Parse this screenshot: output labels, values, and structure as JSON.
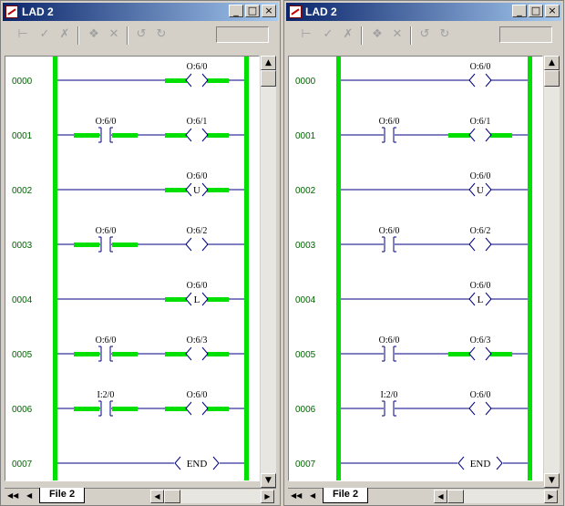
{
  "windows": [
    {
      "title": "LAD 2",
      "tab_label": "File 2",
      "rungs": [
        {
          "number": "0000",
          "inputs": [],
          "output": {
            "address": "O:6/0",
            "symbol": "",
            "energized": true
          }
        },
        {
          "number": "0001",
          "inputs": [
            {
              "address": "O:6/0",
              "energized": true
            }
          ],
          "output": {
            "address": "O:6/1",
            "symbol": "",
            "energized": true
          }
        },
        {
          "number": "0002",
          "inputs": [],
          "output": {
            "address": "O:6/0",
            "symbol": "U",
            "energized": true
          }
        },
        {
          "number": "0003",
          "inputs": [
            {
              "address": "O:6/0",
              "energized": true
            }
          ],
          "output": {
            "address": "O:6/2",
            "symbol": "",
            "energized": false
          }
        },
        {
          "number": "0004",
          "inputs": [],
          "output": {
            "address": "O:6/0",
            "symbol": "L",
            "energized": true
          }
        },
        {
          "number": "0005",
          "inputs": [
            {
              "address": "O:6/0",
              "energized": true
            }
          ],
          "output": {
            "address": "O:6/3",
            "symbol": "",
            "energized": true
          }
        },
        {
          "number": "0006",
          "inputs": [
            {
              "address": "I:2/0",
              "energized": true
            }
          ],
          "output": {
            "address": "O:6/0",
            "symbol": "",
            "energized": true
          }
        },
        {
          "number": "0007",
          "inputs": [],
          "output": {
            "address": "",
            "symbol": "END",
            "energized": false
          }
        }
      ]
    },
    {
      "title": "LAD 2",
      "tab_label": "File 2",
      "rungs": [
        {
          "number": "0000",
          "inputs": [],
          "output": {
            "address": "O:6/0",
            "symbol": "",
            "energized": false
          }
        },
        {
          "number": "0001",
          "inputs": [
            {
              "address": "O:6/0",
              "energized": false
            }
          ],
          "output": {
            "address": "O:6/1",
            "symbol": "",
            "energized": true
          }
        },
        {
          "number": "0002",
          "inputs": [],
          "output": {
            "address": "O:6/0",
            "symbol": "U",
            "energized": false
          }
        },
        {
          "number": "0003",
          "inputs": [
            {
              "address": "O:6/0",
              "energized": false
            }
          ],
          "output": {
            "address": "O:6/2",
            "symbol": "",
            "energized": false
          }
        },
        {
          "number": "0004",
          "inputs": [],
          "output": {
            "address": "O:6/0",
            "symbol": "L",
            "energized": false
          }
        },
        {
          "number": "0005",
          "inputs": [
            {
              "address": "O:6/0",
              "energized": false
            }
          ],
          "output": {
            "address": "O:6/3",
            "symbol": "",
            "energized": true
          }
        },
        {
          "number": "0006",
          "inputs": [
            {
              "address": "I:2/0",
              "energized": false
            }
          ],
          "output": {
            "address": "O:6/0",
            "symbol": "",
            "energized": false
          }
        },
        {
          "number": "0007",
          "inputs": [],
          "output": {
            "address": "",
            "symbol": "END",
            "energized": false
          }
        }
      ]
    }
  ],
  "toolbar_icons": [
    "insert-rung-icon",
    "accept-edits-icon",
    "cancel-edits-icon",
    "verify-icon",
    "delete-icon",
    "undo-icon",
    "redo-icon"
  ],
  "colors": {
    "energized": "#00e000",
    "rung_line": "#000080",
    "rung_number": "#006400",
    "rail": "#00e000"
  }
}
